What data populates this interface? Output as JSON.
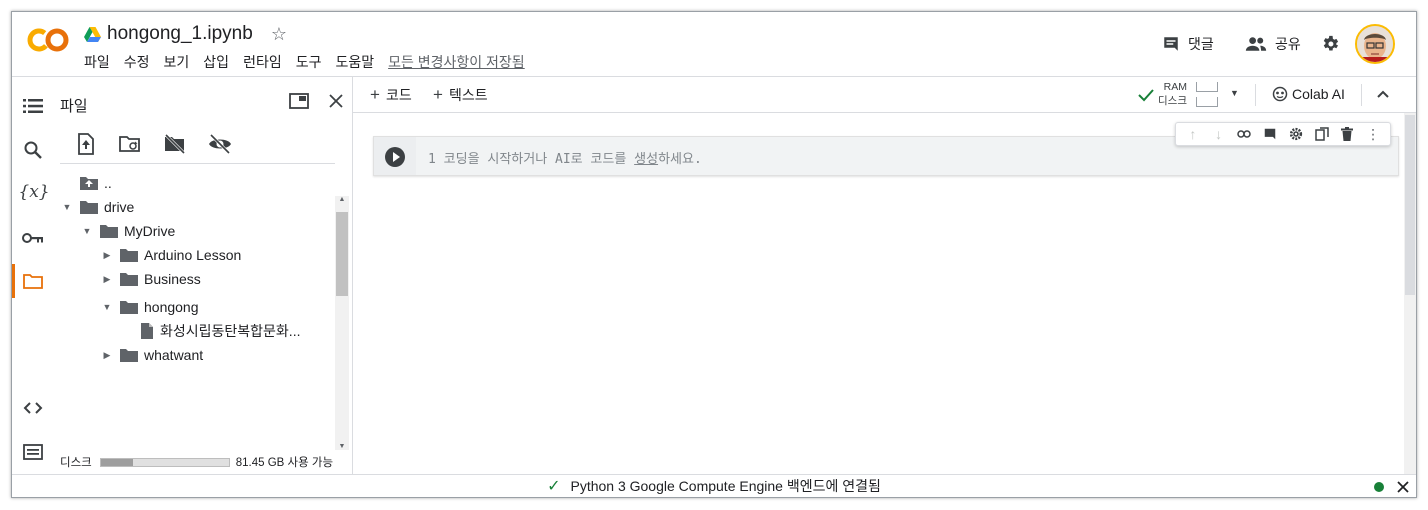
{
  "header": {
    "title": "hongong_1.ipynb",
    "menu": [
      "파일",
      "수정",
      "보기",
      "삽입",
      "런타임",
      "도구",
      "도움말"
    ],
    "saved_status": "모든 변경사항이 저장됨",
    "comments_label": "댓글",
    "share_label": "공유"
  },
  "sidebar": {
    "panel_title": "파일",
    "tree": [
      {
        "label": "..",
        "type": "up"
      },
      {
        "label": "drive",
        "type": "folder",
        "expanded": true
      },
      {
        "label": "MyDrive",
        "type": "folder",
        "expanded": true
      },
      {
        "label": "Arduino Lesson",
        "type": "folder",
        "expanded": false
      },
      {
        "label": "Business",
        "type": "folder",
        "expanded": false
      },
      {
        "label": "hongong",
        "type": "folder",
        "expanded": true
      },
      {
        "label": "화성시립동탄복합문화...",
        "type": "file"
      },
      {
        "label": "whatwant",
        "type": "folder",
        "expanded": false
      }
    ],
    "storage_label": "디스크",
    "storage_free": "81.45 GB 사용 가능",
    "storage_used_fraction": 0.25
  },
  "toolbar": {
    "add_code": "코드",
    "add_text": "텍스트",
    "ram_label": "RAM",
    "disk_label": "디스크",
    "colab_ai": "Colab AI"
  },
  "cell": {
    "line_number": "1",
    "placeholder_before": "코딩을 시작하거나 AI로 코드를 ",
    "placeholder_link": "생성",
    "placeholder_after": "하세요."
  },
  "status": {
    "message": "Python 3 Google Compute Engine 백엔드에 연결됨"
  },
  "colors": {
    "accent": "#e8710a",
    "connected": "#188038",
    "logo_orange": "#f9ab00",
    "logo_dark_orange": "#e8710a"
  }
}
